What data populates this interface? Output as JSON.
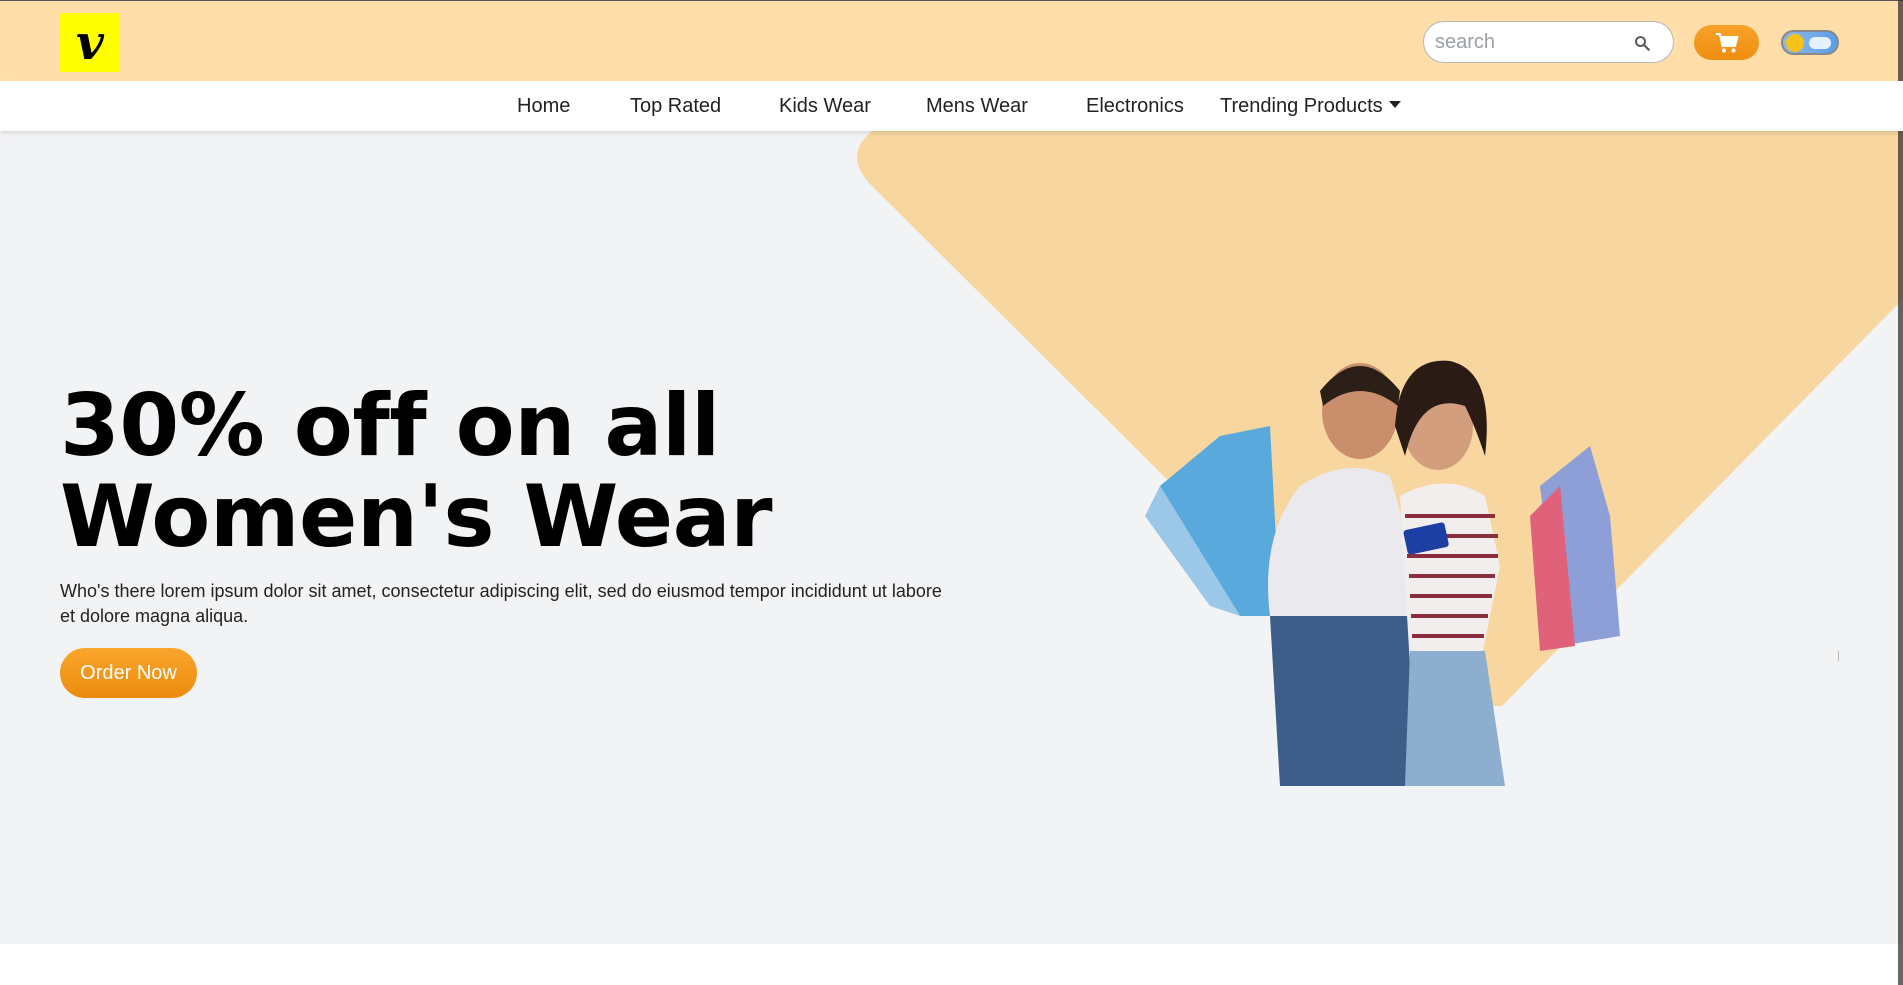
{
  "header": {
    "logo_letter": "v",
    "search_placeholder": "search",
    "cart_icon": "cart-icon",
    "theme_toggle_icon": "theme-toggle"
  },
  "nav": {
    "items": [
      {
        "label": "Home"
      },
      {
        "label": "Top Rated"
      },
      {
        "label": "Kids Wear"
      },
      {
        "label": "Mens Wear"
      },
      {
        "label": "Electronics"
      },
      {
        "label": "Trending Products"
      }
    ]
  },
  "hero": {
    "headline_line1": "30% off on all",
    "headline_line2": "Women's Wear",
    "description": "Who's there lorem ipsum dolor sit amet, consectetur adipiscing elit, sed do eiusmod tempor incididunt ut labore et dolore magna aliqua.",
    "cta_label": "Order Now"
  },
  "colors": {
    "header_bg": "#ffdeaa",
    "accent": "#f39a1e",
    "hero_bg": "#f2f3f5",
    "hero_shape": "#f7d69f",
    "logo_bg": "#ffff00"
  }
}
